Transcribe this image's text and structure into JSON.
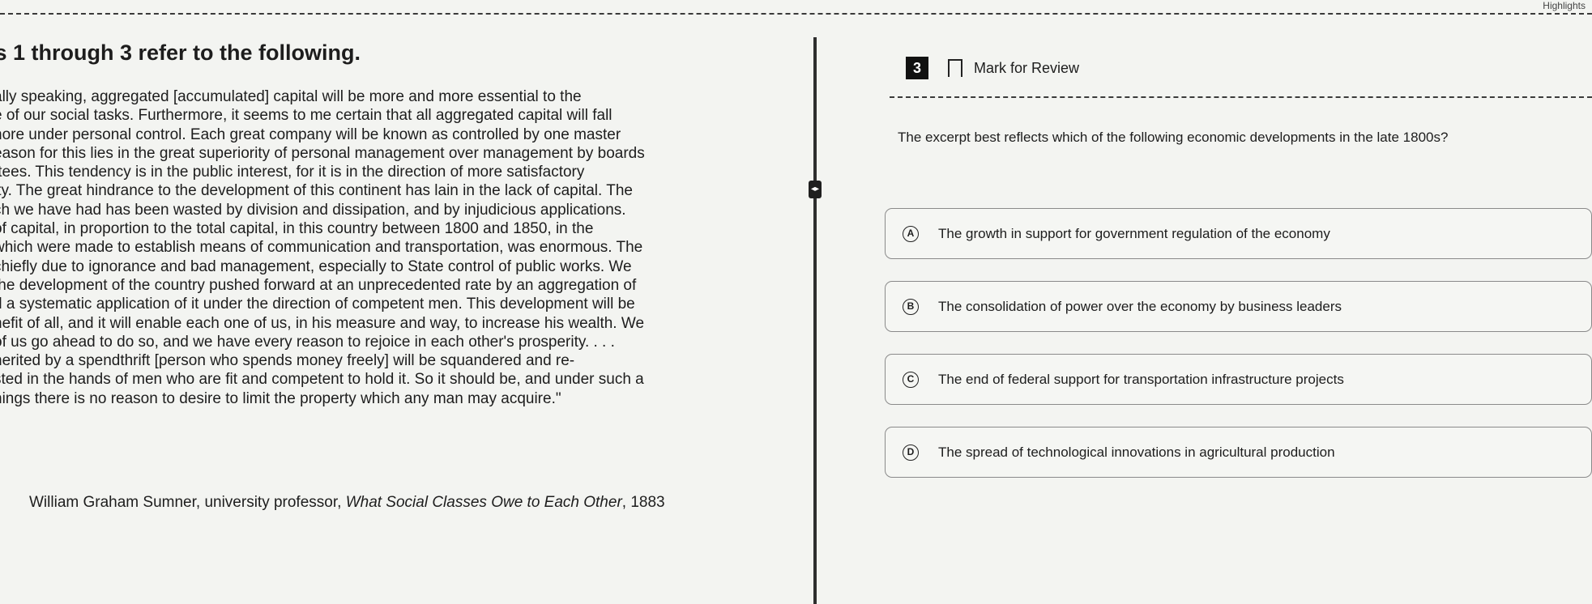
{
  "header": {
    "highlights_label": "Highlights"
  },
  "passage": {
    "heading": "ıs 1 through 3 refer to the following.",
    "lines": [
      "ally speaking, aggregated [accumulated] capital will be more and more essential to the",
      "e of our social tasks. Furthermore, it seems to me certain that all aggregated capital will fall",
      "nore under personal control. Each great company will be known as controlled by one master",
      "eason for this lies in the great superiority of personal management over management by boards",
      "ttees. This tendency is in the public interest, for it is in the direction of more satisfactory",
      "ity. The great hindrance to the development of this continent has lain in the lack of capital. The",
      "ch we have had has been wasted by division and dissipation, and by injudicious applications.",
      "of capital, in proportion to the total capital, in this country between 1800 and 1850, in the",
      "which were made to establish means of communication and transportation, was enormous. The",
      "chiefly due to ignorance and bad management, especially to State control of public works. We",
      "the development of the country pushed forward at an unprecedented rate by an aggregation of",
      "d a systematic application of it under the direction of competent men. This development will be",
      "nefit of all, and it will enable each one of us, in his measure and way, to increase his wealth. We",
      "of us go ahead to do so, and we have every reason to rejoice in each other's prosperity. . . .",
      "herited by a spendthrift [person who spends money freely] will be squandered and re-",
      "sted in the hands of men who are fit and competent to hold it. So it should be, and under such a",
      "hings there is no reason to desire to limit the property which any man may acquire.\""
    ],
    "attribution_author": "William Graham Sumner, university professor, ",
    "attribution_title": "What Social Classes Owe to Each Other",
    "attribution_year": ", 1883"
  },
  "divider": {
    "handle_symbol": "◂▸"
  },
  "question": {
    "number": "3",
    "mark_for_review": "Mark for Review",
    "stem": "The excerpt best reflects which of the following economic developments in the late 1800s?",
    "options": [
      {
        "letter": "A",
        "text": "The growth in support for government regulation of the economy"
      },
      {
        "letter": "B",
        "text": "The consolidation of power over the economy by business leaders"
      },
      {
        "letter": "C",
        "text": "The end of federal support for transportation infrastructure projects"
      },
      {
        "letter": "D",
        "text": "The spread of technological innovations in agricultural production"
      }
    ]
  }
}
